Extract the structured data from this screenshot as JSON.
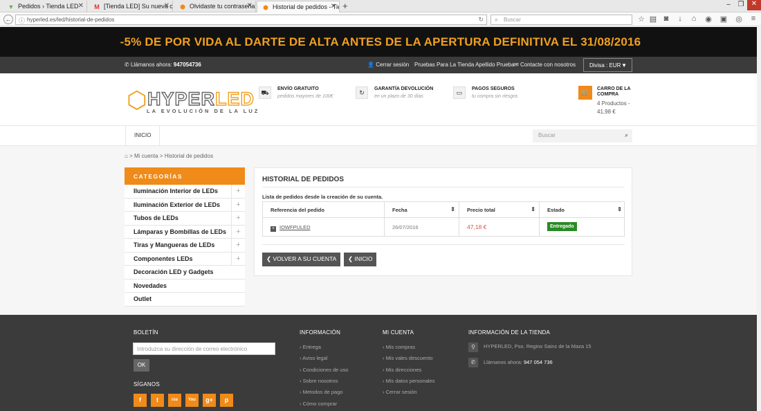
{
  "browser": {
    "tabs": [
      {
        "label": "Pedidos › Tienda LED",
        "icon": "tienda-favicon"
      },
      {
        "label": "[Tienda LED] Su nueva cla...",
        "icon": "gmail-favicon"
      },
      {
        "label": "Olvidaste tu contraseña - ...",
        "icon": "hyperled-favicon"
      },
      {
        "label": "Historial de pedidos - Tien...",
        "icon": "hyperled-favicon"
      }
    ],
    "url": "hyperled.es/led/historial-de-pedidos",
    "search_placeholder": "Buscar"
  },
  "promo_banner": "-5% DE POR VIDA AL DARTE DE ALTA ANTES DE LA APERTURA DEFINITIVA EL 31/08/2016",
  "topnav": {
    "phone_label": "Llámanos ahora:",
    "phone": "947054736",
    "logout": "Cerrar sesión",
    "user": "Pruebas Para La Tienda Apellido Prueba",
    "contact": "Contacte con nosotros",
    "currency": "Divisa : EUR"
  },
  "logo": {
    "name_a": "HYPER",
    "name_b": "LED",
    "tagline": "LA EVOLUCIÓN DE LA LUZ"
  },
  "features": [
    {
      "title": "ENVÍO GRATUITO",
      "sub": "pedidos mayores de 100€",
      "icon": "truck-icon"
    },
    {
      "title": "GARANTÍA DEVOLUCIÓN",
      "sub": "en un plazo de 30 días",
      "icon": "refresh-icon"
    },
    {
      "title": "PAGOS SEGUROS",
      "sub": "tu compra sin riesgos",
      "icon": "credit-card-icon"
    }
  ],
  "cart": {
    "title": "CARRO DE LA COMPRA",
    "summary": "4 Productos - 41,98 €"
  },
  "menu": {
    "home": "INICIO",
    "search_placeholder": "Buscar"
  },
  "breadcrumb": {
    "sep": ">",
    "account": "Mi cuenta",
    "current": "Historial de pedidos"
  },
  "sidebar": {
    "title": "CATEGORÍAS",
    "items": [
      {
        "label": "Iluminación Interior de LEDs",
        "expandable": true
      },
      {
        "label": "Iluminación Exterior de LEDs",
        "expandable": true
      },
      {
        "label": "Tubos de LEDs",
        "expandable": true
      },
      {
        "label": "Lámparas y Bombillas de LEDs",
        "expandable": true
      },
      {
        "label": "Tiras y Mangueras de LEDs",
        "expandable": true
      },
      {
        "label": "Componentes LEDs",
        "expandable": true
      },
      {
        "label": "Decoración LED y Gadgets",
        "expandable": false
      },
      {
        "label": "Novedades",
        "expandable": false
      },
      {
        "label": "Outlet",
        "expandable": false
      }
    ]
  },
  "orders": {
    "title": "HISTORIAL DE PEDIDOS",
    "subtitle": "Lista de pedidos desde la creación de su cuenta.",
    "headers": [
      "Referencia del pedido",
      "Fecha",
      "Precio total",
      "Estado"
    ],
    "rows": [
      {
        "ref": "IOWFPULED",
        "date": "26/07/2016",
        "total": "47,18 €",
        "status": "Entregado"
      }
    ],
    "back_button": "VOLVER A SU CUENTA",
    "home_button": "INICIO"
  },
  "footer": {
    "newsletter": {
      "title": "BOLETÍN",
      "placeholder": "Introduzca su dirección de correo electrónico",
      "ok": "OK"
    },
    "follow": "SÍGANOS",
    "social": [
      "f",
      "t",
      "rss",
      "You",
      "g+",
      "p"
    ],
    "info": {
      "title": "INFORMACIÓN",
      "links": [
        "Entrega",
        "Aviso legal",
        "Condiciones de uso",
        "Sobre nosotros",
        "Metodos de pago",
        "Cómo comprar"
      ]
    },
    "account": {
      "title": "MI CUENTA",
      "links": [
        "Mis compras",
        "Mis vales descuento",
        "Mis direcciones",
        "Mis datos personales",
        "Cerrar sesión"
      ]
    },
    "store": {
      "title": "INFORMACIÓN DE LA TIENDA",
      "address": "HYPERLED, Pso. Regino Sainz de la Maza 15",
      "phone_label": "Llámanos ahora:",
      "phone": "947 054 736"
    }
  },
  "colors": {
    "accent": "#f08a18",
    "dark": "#3b3b3b",
    "success": "#2a8a25",
    "price": "#d9534f"
  }
}
